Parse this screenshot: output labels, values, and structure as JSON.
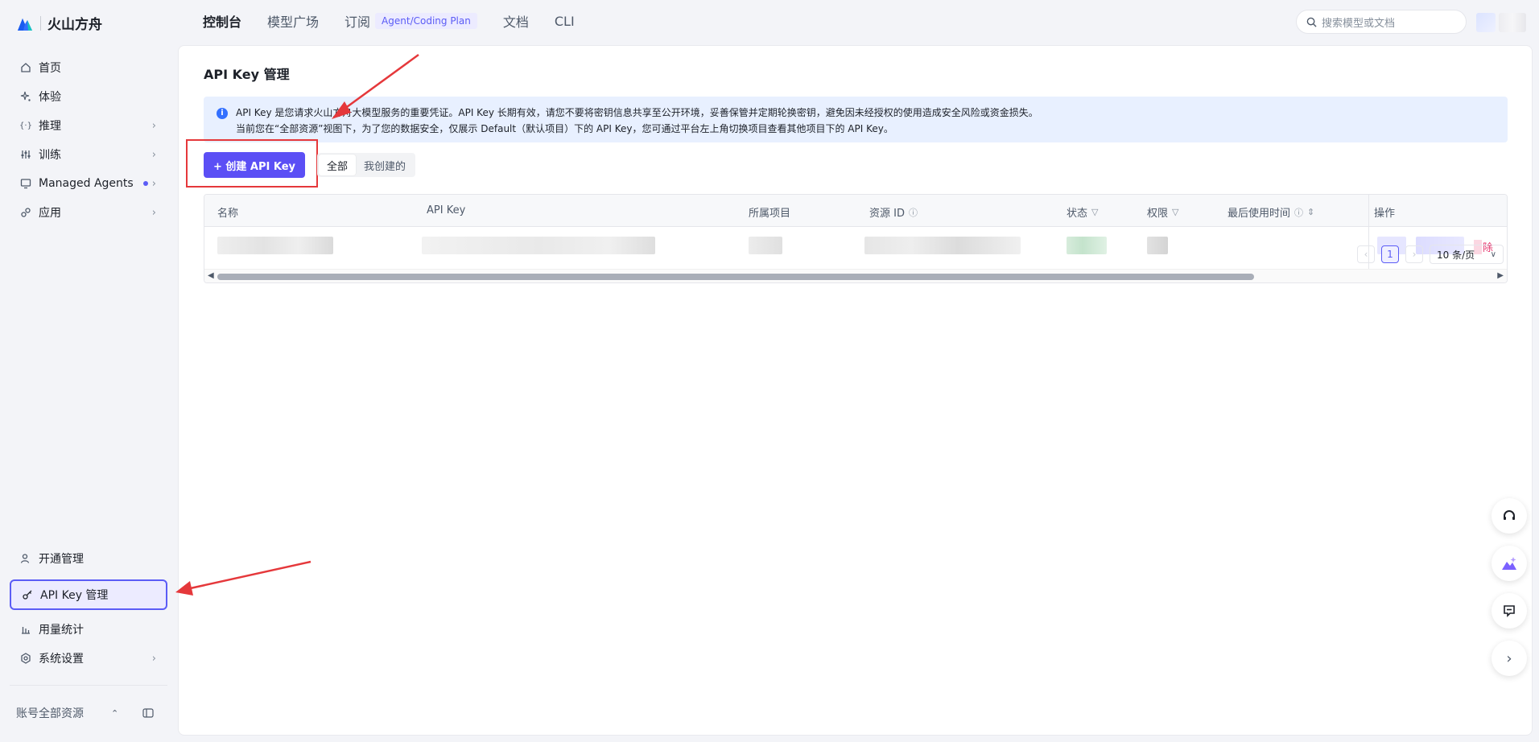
{
  "brand": {
    "name": "火山方舟"
  },
  "topnav": {
    "items": [
      "控制台",
      "模型广场",
      "订阅",
      "文档",
      "CLI"
    ],
    "plan_badge": "Agent/Coding Plan"
  },
  "search": {
    "placeholder": "搜索模型或文档"
  },
  "sidebar": {
    "items": [
      {
        "label": "首页",
        "icon": "home-icon"
      },
      {
        "label": "体验",
        "icon": "sparkle-icon"
      },
      {
        "label": "推理",
        "icon": "code-icon"
      },
      {
        "label": "训练",
        "icon": "sliders-icon"
      },
      {
        "label": "Managed Agents",
        "icon": "monitor-icon"
      },
      {
        "label": "应用",
        "icon": "link-icon"
      }
    ],
    "bottom_items": [
      {
        "label": "开通管理",
        "icon": "user-icon"
      },
      {
        "label": "API Key 管理",
        "icon": "key-icon"
      },
      {
        "label": "用量统计",
        "icon": "bar-chart-icon"
      },
      {
        "label": "系统设置",
        "icon": "gear-icon"
      }
    ],
    "account_label": "账号全部资源"
  },
  "main": {
    "title": "API Key 管理",
    "notice_line1": "API Key 是您请求火山方舟大模型服务的重要凭证。API Key 长期有效，请您不要将密钥信息共享至公开环境，妥善保管并定期轮换密钥，避免因未经授权的使用造成安全风险或资金损失。",
    "notice_line2": "当前您在“全部资源”视图下，为了您的数据安全，仅展示 Default（默认项目）下的 API Key，您可通过平台左上角切换项目查看其他项目下的 API Key。",
    "create_button": "+ 创建 API Key",
    "tabs": [
      "全部",
      "我创建的"
    ],
    "table": {
      "columns": [
        "名称",
        "API Key",
        "所属项目",
        "资源 ID",
        "状态",
        "权限",
        "最后使用时间",
        "操作"
      ],
      "row_action_delete": "除"
    },
    "pagination": {
      "current": "1",
      "page_size": "10 条/页"
    }
  },
  "colors": {
    "accent": "#5b4ff5",
    "annotation": "#e5383b",
    "notice_bg": "#e8f0ff"
  }
}
